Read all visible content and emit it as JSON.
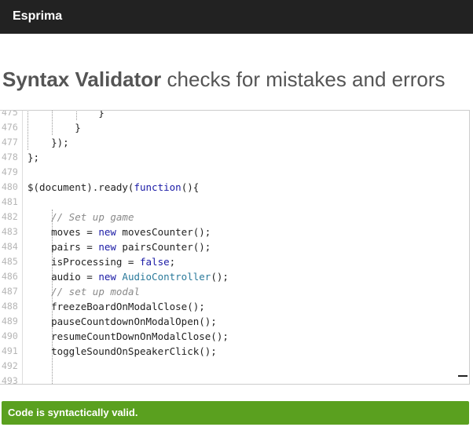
{
  "navbar": {
    "brand": "Esprima"
  },
  "page": {
    "title_strong": "Syntax Validator",
    "title_rest": " checks for mistakes and errors"
  },
  "editor": {
    "lines": [
      {
        "number": "475",
        "tokens": [
          {
            "t": "            }",
            "k": "plain"
          }
        ]
      },
      {
        "number": "476",
        "tokens": [
          {
            "t": "        }",
            "k": "plain"
          }
        ]
      },
      {
        "number": "477",
        "tokens": [
          {
            "t": "    });",
            "k": "plain"
          }
        ]
      },
      {
        "number": "478",
        "tokens": [
          {
            "t": "};",
            "k": "plain"
          }
        ]
      },
      {
        "number": "479",
        "tokens": []
      },
      {
        "number": "480",
        "tokens": [
          {
            "t": "$(document).ready(",
            "k": "plain"
          },
          {
            "t": "function",
            "k": "kw"
          },
          {
            "t": "(){",
            "k": "plain"
          }
        ]
      },
      {
        "number": "481",
        "tokens": []
      },
      {
        "number": "482",
        "tokens": [
          {
            "t": "    ",
            "k": "plain"
          },
          {
            "t": "// Set up game",
            "k": "cm"
          }
        ]
      },
      {
        "number": "483",
        "tokens": [
          {
            "t": "    moves = ",
            "k": "plain"
          },
          {
            "t": "new",
            "k": "kw"
          },
          {
            "t": " movesCounter();",
            "k": "plain"
          }
        ]
      },
      {
        "number": "484",
        "tokens": [
          {
            "t": "    pairs = ",
            "k": "plain"
          },
          {
            "t": "new",
            "k": "kw"
          },
          {
            "t": " pairsCounter();",
            "k": "plain"
          }
        ]
      },
      {
        "number": "485",
        "tokens": [
          {
            "t": "    isProcessing = ",
            "k": "plain"
          },
          {
            "t": "false",
            "k": "kw"
          },
          {
            "t": ";",
            "k": "plain"
          }
        ]
      },
      {
        "number": "486",
        "tokens": [
          {
            "t": "    audio = ",
            "k": "plain"
          },
          {
            "t": "new",
            "k": "kw"
          },
          {
            "t": " ",
            "k": "plain"
          },
          {
            "t": "AudioController",
            "k": "cls"
          },
          {
            "t": "();",
            "k": "plain"
          }
        ]
      },
      {
        "number": "487",
        "tokens": [
          {
            "t": "    ",
            "k": "plain"
          },
          {
            "t": "// set up modal",
            "k": "cm"
          }
        ]
      },
      {
        "number": "488",
        "tokens": [
          {
            "t": "    freezeBoardOnModalClose();",
            "k": "plain"
          }
        ]
      },
      {
        "number": "489",
        "tokens": [
          {
            "t": "    pauseCountdownOnModalOpen();",
            "k": "plain"
          }
        ]
      },
      {
        "number": "490",
        "tokens": [
          {
            "t": "    resumeCountDownOnModalClose();",
            "k": "plain"
          }
        ]
      },
      {
        "number": "491",
        "tokens": [
          {
            "t": "    toggleSoundOnSpeakerClick();",
            "k": "plain"
          }
        ]
      },
      {
        "number": "492",
        "tokens": []
      },
      {
        "number": "493",
        "tokens": []
      }
    ]
  },
  "result": {
    "message": "Code is syntactically valid.",
    "color": "#5aa01f"
  }
}
